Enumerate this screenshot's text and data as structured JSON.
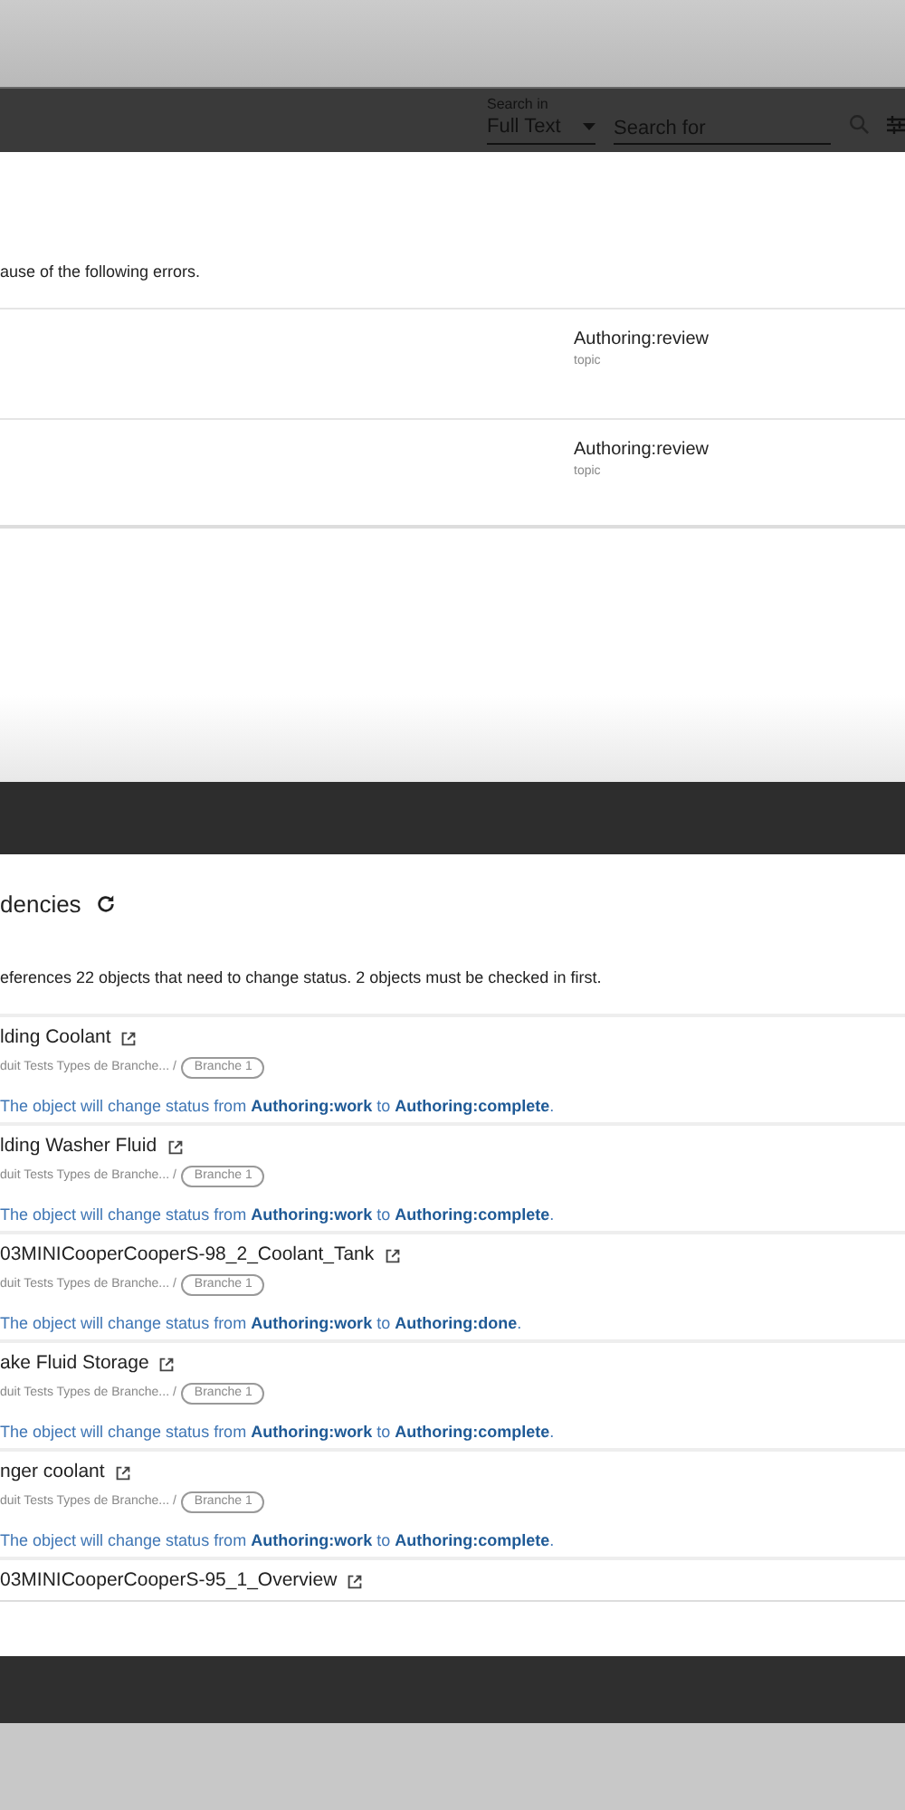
{
  "top_bar": {
    "search_in_label": "Search in",
    "search_scope": "Full Text",
    "search_placeholder": "Search for"
  },
  "errors_panel": {
    "message": "ause of the following errors.",
    "rows": [
      {
        "status": "Authoring:review",
        "type": "topic"
      },
      {
        "status": "Authoring:review",
        "type": "topic"
      }
    ]
  },
  "dependencies_panel": {
    "title": "dencies",
    "summary": "eferences 22 objects that need to change status. 2 objects must be checked in first.",
    "items": [
      {
        "title": "lding Coolant",
        "path": "duit Tests Types de Branche... /",
        "branch": "Branche 1",
        "message": "The object will change status from **Authoring:work** to **Authoring:complete**."
      },
      {
        "title": "lding Washer Fluid",
        "path": "duit Tests Types de Branche... /",
        "branch": "Branche 1",
        "message": "The object will change status from **Authoring:work** to **Authoring:complete**."
      },
      {
        "title": "03MINICooperCooperS-98_2_Coolant_Tank",
        "path": "duit Tests Types de Branche... /",
        "branch": "Branche 1",
        "message": "The object will change status from **Authoring:work** to **Authoring:done**."
      },
      {
        "title": "ake Fluid Storage",
        "path": "duit Tests Types de Branche... /",
        "branch": "Branche 1",
        "message": "The object will change status from **Authoring:work** to **Authoring:complete**."
      },
      {
        "title": "nger coolant",
        "path": "duit Tests Types de Branche... /",
        "branch": "Branche 1",
        "message": "The object will change status from **Authoring:work** to **Authoring:complete**."
      },
      {
        "title": "03MINICooperCooperS-95_1_Overview"
      }
    ]
  }
}
